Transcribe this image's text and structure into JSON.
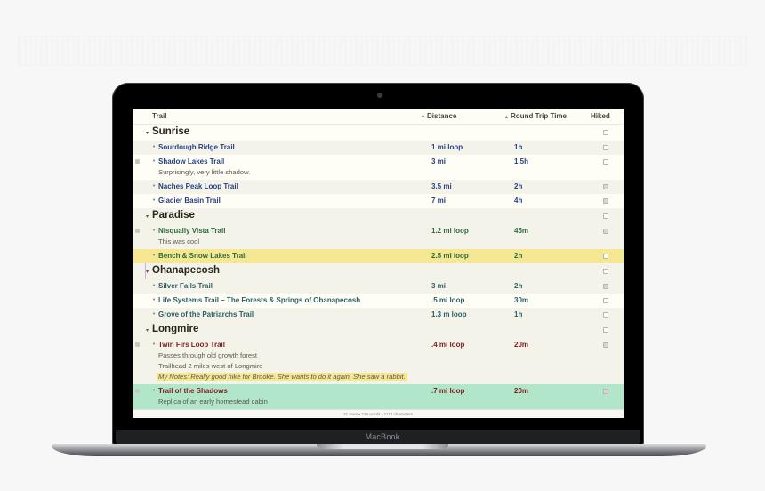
{
  "device": {
    "brand_label": "MacBook"
  },
  "columns": {
    "trail": "Trail",
    "distance": "Distance",
    "distance_sort_icon": "sort-descending-icon",
    "round_trip": "Round Trip Time",
    "round_trip_sort_icon": "sort-ascending-icon",
    "hiked": "Hiked"
  },
  "groups": [
    {
      "title": "Sunrise",
      "hiked": false,
      "color": "#263f80",
      "trails": [
        {
          "name": "Sourdough Ridge Trail",
          "distance": "1 mi loop",
          "time": "1h",
          "hiked": false,
          "notes": []
        },
        {
          "name": "Shadow Lakes Trail",
          "distance": "3 mi",
          "time": "1.5h",
          "hiked": false,
          "notes": [
            "Surprisingly, very little shadow."
          ]
        },
        {
          "name": "Naches Peak Loop Trail",
          "distance": "3.5 mi",
          "time": "2h",
          "hiked": true,
          "notes": []
        },
        {
          "name": "Glacier Basin Trail",
          "distance": "7 mi",
          "time": "4h",
          "hiked": true,
          "notes": []
        }
      ]
    },
    {
      "title": "Paradise",
      "hiked": false,
      "color": "#2e6b3c",
      "trails": [
        {
          "name": "Nisqually Vista Trail",
          "distance": "1.2 mi loop",
          "time": "45m",
          "hiked": true,
          "notes": [
            "This was cool"
          ]
        },
        {
          "name": "Bench & Snow Lakes Trail",
          "distance": "2.5 mi loop",
          "time": "2h",
          "hiked": false,
          "notes": [],
          "highlight": "yellow"
        }
      ]
    },
    {
      "title": "Ohanapecosh",
      "hiked": false,
      "color": "#2c5e63",
      "trails": [
        {
          "name": "Silver Falls Trail",
          "distance": "3 mi",
          "time": "2h",
          "hiked": true,
          "notes": []
        },
        {
          "name": "Life Systems Trail – The Forests & Springs of Ohanapecosh",
          "distance": ".5 mi loop",
          "time": "30m",
          "hiked": false,
          "notes": []
        },
        {
          "name": "Grove of the Patriarchs Trail",
          "distance": "1.3 m loop",
          "time": "1h",
          "hiked": false,
          "notes": []
        }
      ]
    },
    {
      "title": "Longmire",
      "hiked": false,
      "color": "#7a1f1f",
      "trails": [
        {
          "name": "Twin Firs Loop Trail",
          "distance": ".4 mi loop",
          "time": "20m",
          "hiked": true,
          "notes": [
            "Passes through old growth forest",
            "Trailhead 2 miles west of Longmire"
          ],
          "highlighted_note": "My Notes: Really good hike for Brooke. She wants to do it again. She saw a rabbit."
        },
        {
          "name": "Trail of the Shadows",
          "distance": ".7 mi loop",
          "time": "20m",
          "hiked": true,
          "notes": [
            "Replica of an early homestead cabin"
          ],
          "highlight": "green"
        }
      ]
    }
  ],
  "status_bar": "21 rows • 218 words • 1110 characters"
}
